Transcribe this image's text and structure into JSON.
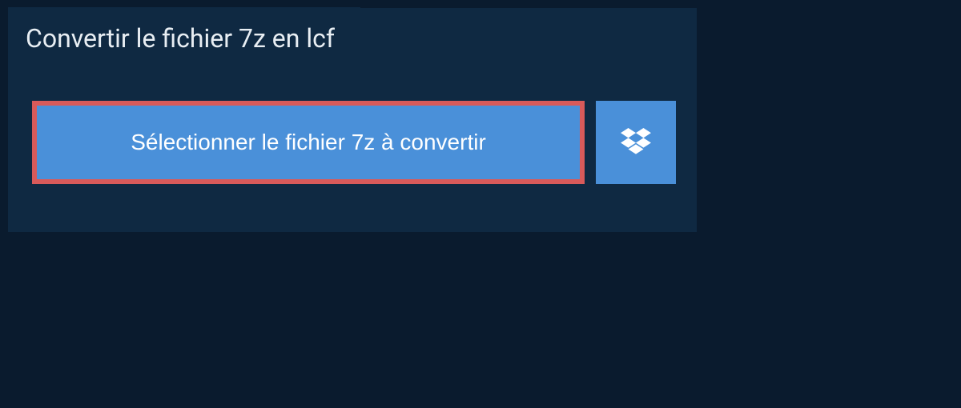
{
  "header": {
    "title": "Convertir le fichier 7z en lcf"
  },
  "upload": {
    "select_label": "Sélectionner le fichier 7z à convertir"
  }
}
